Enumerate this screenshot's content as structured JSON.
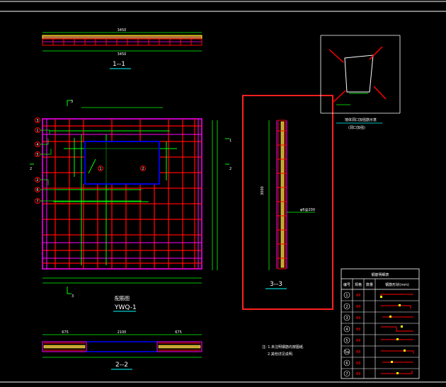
{
  "drawing": {
    "section_1": {
      "label": "1--1",
      "dim_top": "3450",
      "dim_bottom": "3450"
    },
    "plan": {
      "title": "配筋图",
      "name": "YWQ-1",
      "top_mark": "3",
      "bottom_mark": "3",
      "left_mark": "2",
      "right_mark_1": "1",
      "right_mark_2": "2",
      "rebar_callouts": [
        "3",
        "1",
        "4",
        "5",
        "2",
        "6",
        "7"
      ],
      "opening_callouts": [
        "1",
        "2"
      ]
    },
    "section_3": {
      "label": "3--3",
      "note_label": "φ6@200",
      "dim_total": "3000"
    },
    "section_2": {
      "label": "2--2",
      "dim_left": "675",
      "dim_mid": "2100",
      "dim_right": "675"
    },
    "detail": {
      "caption": "墙体洞口加强筋示意",
      "subcaption": "(洞口加强)"
    },
    "notes": {
      "line1": "注: 1.未注明钢筋均按图纸.",
      "line2": "2.其他详见说明."
    },
    "table": {
      "title": "钢筋明细表",
      "headers": [
        "编号",
        "规格",
        "数量",
        "钢筋形状(mm)"
      ],
      "rows": [
        {
          "no": "1",
          "spec": "Φ8"
        },
        {
          "no": "2",
          "spec": "Φ8"
        },
        {
          "no": "3",
          "spec": "Φ8"
        },
        {
          "no": "4",
          "spec": "Φ8"
        },
        {
          "no": "5",
          "spec": "Φ8"
        },
        {
          "no": "5a",
          "spec": "Φ8"
        },
        {
          "no": "6",
          "spec": "Φ8"
        },
        {
          "no": "7",
          "spec": "Φ8"
        }
      ]
    }
  },
  "colors": {
    "background": "#000000",
    "frame": "#ffffff",
    "rebar_magenta": "#ff00ff",
    "rebar_red": "#ff0000",
    "rebar_green": "#00ff00",
    "opening_blue": "#0000ff",
    "concrete_yellow": "#ffff00",
    "dimension": "#00ff00",
    "highlight_box": "#ff2020"
  }
}
